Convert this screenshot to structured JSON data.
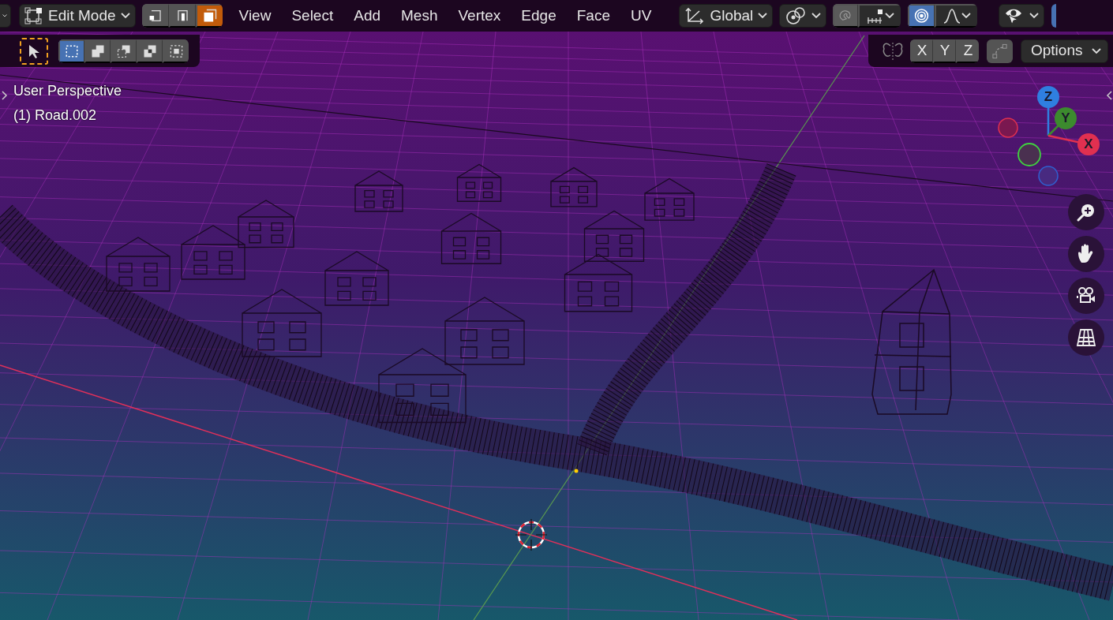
{
  "header": {
    "mode_menu": {
      "label": "Edit Mode"
    },
    "select_modes": [
      {
        "kind": "vertex",
        "selected": false
      },
      {
        "kind": "edge",
        "selected": false
      },
      {
        "kind": "face",
        "selected": true
      }
    ],
    "menus": [
      "View",
      "Select",
      "Add",
      "Mesh",
      "Vertex",
      "Edge",
      "Face",
      "UV"
    ],
    "orientation_menu": {
      "label": "Global"
    },
    "snap": {
      "on": false
    },
    "proportional_editing": {
      "on": true
    }
  },
  "tool_header": {
    "tools": [
      {
        "kind": "tweak",
        "selected": true
      }
    ],
    "box_modes": [
      {
        "kind": "new",
        "selected": true
      },
      {
        "kind": "extend",
        "selected": false
      },
      {
        "kind": "subtract",
        "selected": false
      },
      {
        "kind": "invert",
        "selected": false
      },
      {
        "kind": "intersect",
        "selected": false
      }
    ]
  },
  "mirror_options": {
    "axes": [
      {
        "label": "X",
        "on": false
      },
      {
        "label": "Y",
        "on": false
      },
      {
        "label": "Z",
        "on": false
      }
    ],
    "options_menu": {
      "label": "Options"
    }
  },
  "viewport_info": [
    "User Perspective",
    "(1) Road.002"
  ],
  "gizmo": {
    "axes": [
      {
        "label": "Z",
        "color": "#2f7fe0"
      },
      {
        "label": "Y",
        "color": "#3c8a2e"
      },
      {
        "label": "X",
        "color": "#e03050"
      }
    ]
  },
  "nav_buttons": [
    {
      "kind": "zoom"
    },
    {
      "kind": "pan"
    },
    {
      "kind": "camera"
    },
    {
      "kind": "ortho"
    }
  ]
}
